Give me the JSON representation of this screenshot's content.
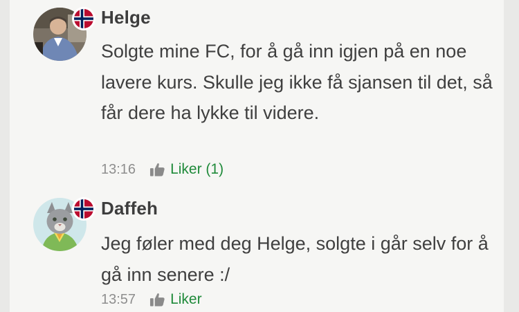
{
  "comments": [
    {
      "author": "Helge",
      "text": "Solgte mine FC, for å gå inn igjen på en noe lavere kurs. Skulle jeg ikke få sjansen til det, så får dere ha lykke til videre.",
      "time": "13:16",
      "like_label": "Liker (1)",
      "flag": "norway-flag",
      "avatar": "user-photo"
    },
    {
      "author": "Daffeh",
      "text": "Jeg føler med deg Helge, solgte i går selv for å gå inn senere :/",
      "time": "13:57",
      "like_label": "Liker",
      "flag": "norway-flag",
      "avatar": "cat-illustration"
    }
  ],
  "colors": {
    "background": "#f6f6f4",
    "author": "#3d3d3d",
    "text": "#3f3f3f",
    "time": "#8e8e8e",
    "like": "#1f8a3a",
    "like_icon": "#8a8a8a",
    "flag_red": "#ba0c2f",
    "flag_blue": "#00205b"
  }
}
